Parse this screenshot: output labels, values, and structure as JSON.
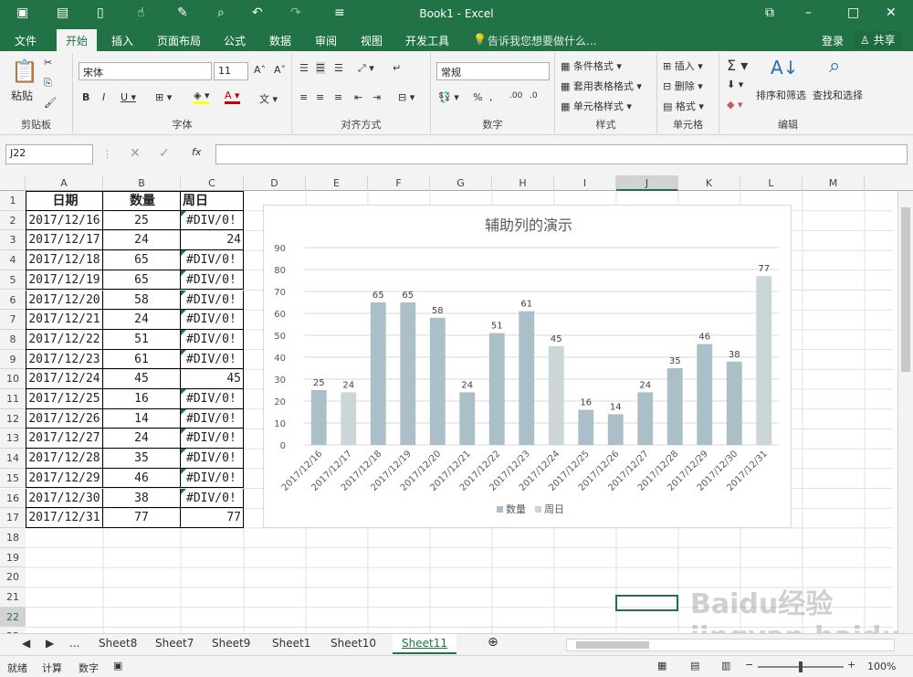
{
  "titlebar": {
    "title": "Book1 - Excel",
    "min": "–",
    "max": "□",
    "close": "✕",
    "restore": "⧉"
  },
  "tabs": [
    "文件",
    "开始",
    "插入",
    "页面布局",
    "公式",
    "数据",
    "审阅",
    "视图",
    "开发工具"
  ],
  "tell_me": "告诉我您想要做什么...",
  "login": "登录",
  "share": "共享",
  "ribbon": {
    "paste": "粘贴",
    "clipboard": "剪贴板",
    "font_name": "宋体",
    "font_size": "11",
    "font_group": "字体",
    "align_group": "对齐方式",
    "number_format": "常规",
    "number_group": "数字",
    "cond_format": "条件格式",
    "table_format": "套用表格格式",
    "cell_style": "单元格样式",
    "styles_group": "样式",
    "insert": "插入",
    "delete": "删除",
    "format": "格式",
    "cells_group": "单元格",
    "sort_filter": "排序和筛选",
    "find_select": "查找和选择",
    "edit_group": "编辑"
  },
  "formula_bar": {
    "name_box": "J22",
    "fx": "fx",
    "value": ""
  },
  "columns": [
    "A",
    "B",
    "C",
    "D",
    "E",
    "F",
    "G",
    "H",
    "I",
    "J",
    "K",
    "L",
    "M"
  ],
  "rows": [
    "1",
    "2",
    "3",
    "4",
    "5",
    "6",
    "7",
    "8",
    "9",
    "10",
    "11",
    "12",
    "13",
    "14",
    "15",
    "16",
    "17",
    "18",
    "19",
    "20",
    "21",
    "22",
    "23"
  ],
  "table": {
    "headers": [
      "日期",
      "数量",
      "周日"
    ],
    "rows": [
      [
        "2017/12/16",
        "25",
        "#DIV/0!"
      ],
      [
        "2017/12/17",
        "24",
        "24"
      ],
      [
        "2017/12/18",
        "65",
        "#DIV/0!"
      ],
      [
        "2017/12/19",
        "65",
        "#DIV/0!"
      ],
      [
        "2017/12/20",
        "58",
        "#DIV/0!"
      ],
      [
        "2017/12/21",
        "24",
        "#DIV/0!"
      ],
      [
        "2017/12/22",
        "51",
        "#DIV/0!"
      ],
      [
        "2017/12/23",
        "61",
        "#DIV/0!"
      ],
      [
        "2017/12/24",
        "45",
        "45"
      ],
      [
        "2017/12/25",
        "16",
        "#DIV/0!"
      ],
      [
        "2017/12/26",
        "14",
        "#DIV/0!"
      ],
      [
        "2017/12/27",
        "24",
        "#DIV/0!"
      ],
      [
        "2017/12/28",
        "35",
        "#DIV/0!"
      ],
      [
        "2017/12/29",
        "46",
        "#DIV/0!"
      ],
      [
        "2017/12/30",
        "38",
        "#DIV/0!"
      ],
      [
        "2017/12/31",
        "77",
        "77"
      ]
    ]
  },
  "chart_data": {
    "type": "bar",
    "title": "辅助列的演示",
    "categories": [
      "2017/12/16",
      "2017/12/17",
      "2017/12/18",
      "2017/12/19",
      "2017/12/20",
      "2017/12/21",
      "2017/12/22",
      "2017/12/23",
      "2017/12/24",
      "2017/12/25",
      "2017/12/26",
      "2017/12/27",
      "2017/12/28",
      "2017/12/29",
      "2017/12/30",
      "2017/12/31"
    ],
    "values": [
      25,
      24,
      65,
      65,
      58,
      24,
      51,
      61,
      45,
      16,
      14,
      24,
      35,
      46,
      38,
      77
    ],
    "highlight": [
      false,
      true,
      false,
      false,
      false,
      false,
      false,
      false,
      true,
      false,
      false,
      false,
      false,
      false,
      false,
      true
    ],
    "series": [
      {
        "name": "数量",
        "color": "#abbfc9"
      },
      {
        "name": "周日",
        "color": "#ccd5d8"
      }
    ],
    "ylim": [
      0,
      90
    ],
    "yticks": [
      0,
      10,
      20,
      30,
      40,
      50,
      60,
      70,
      80,
      90
    ],
    "legend": "bottom",
    "grid": true
  },
  "sheets": [
    "...",
    "Sheet8",
    "Sheet7",
    "Sheet9",
    "Sheet1",
    "Sheet10",
    "Sheet11"
  ],
  "active_sheet": "Sheet11",
  "status": {
    "ready": "就绪",
    "calc": "计算",
    "digits": "数字",
    "zoom": "100%"
  },
  "watermark": "Baidu经验 jingyan.baidu.com",
  "colors": {
    "excel_green": "#217346",
    "accent": "#217346"
  }
}
